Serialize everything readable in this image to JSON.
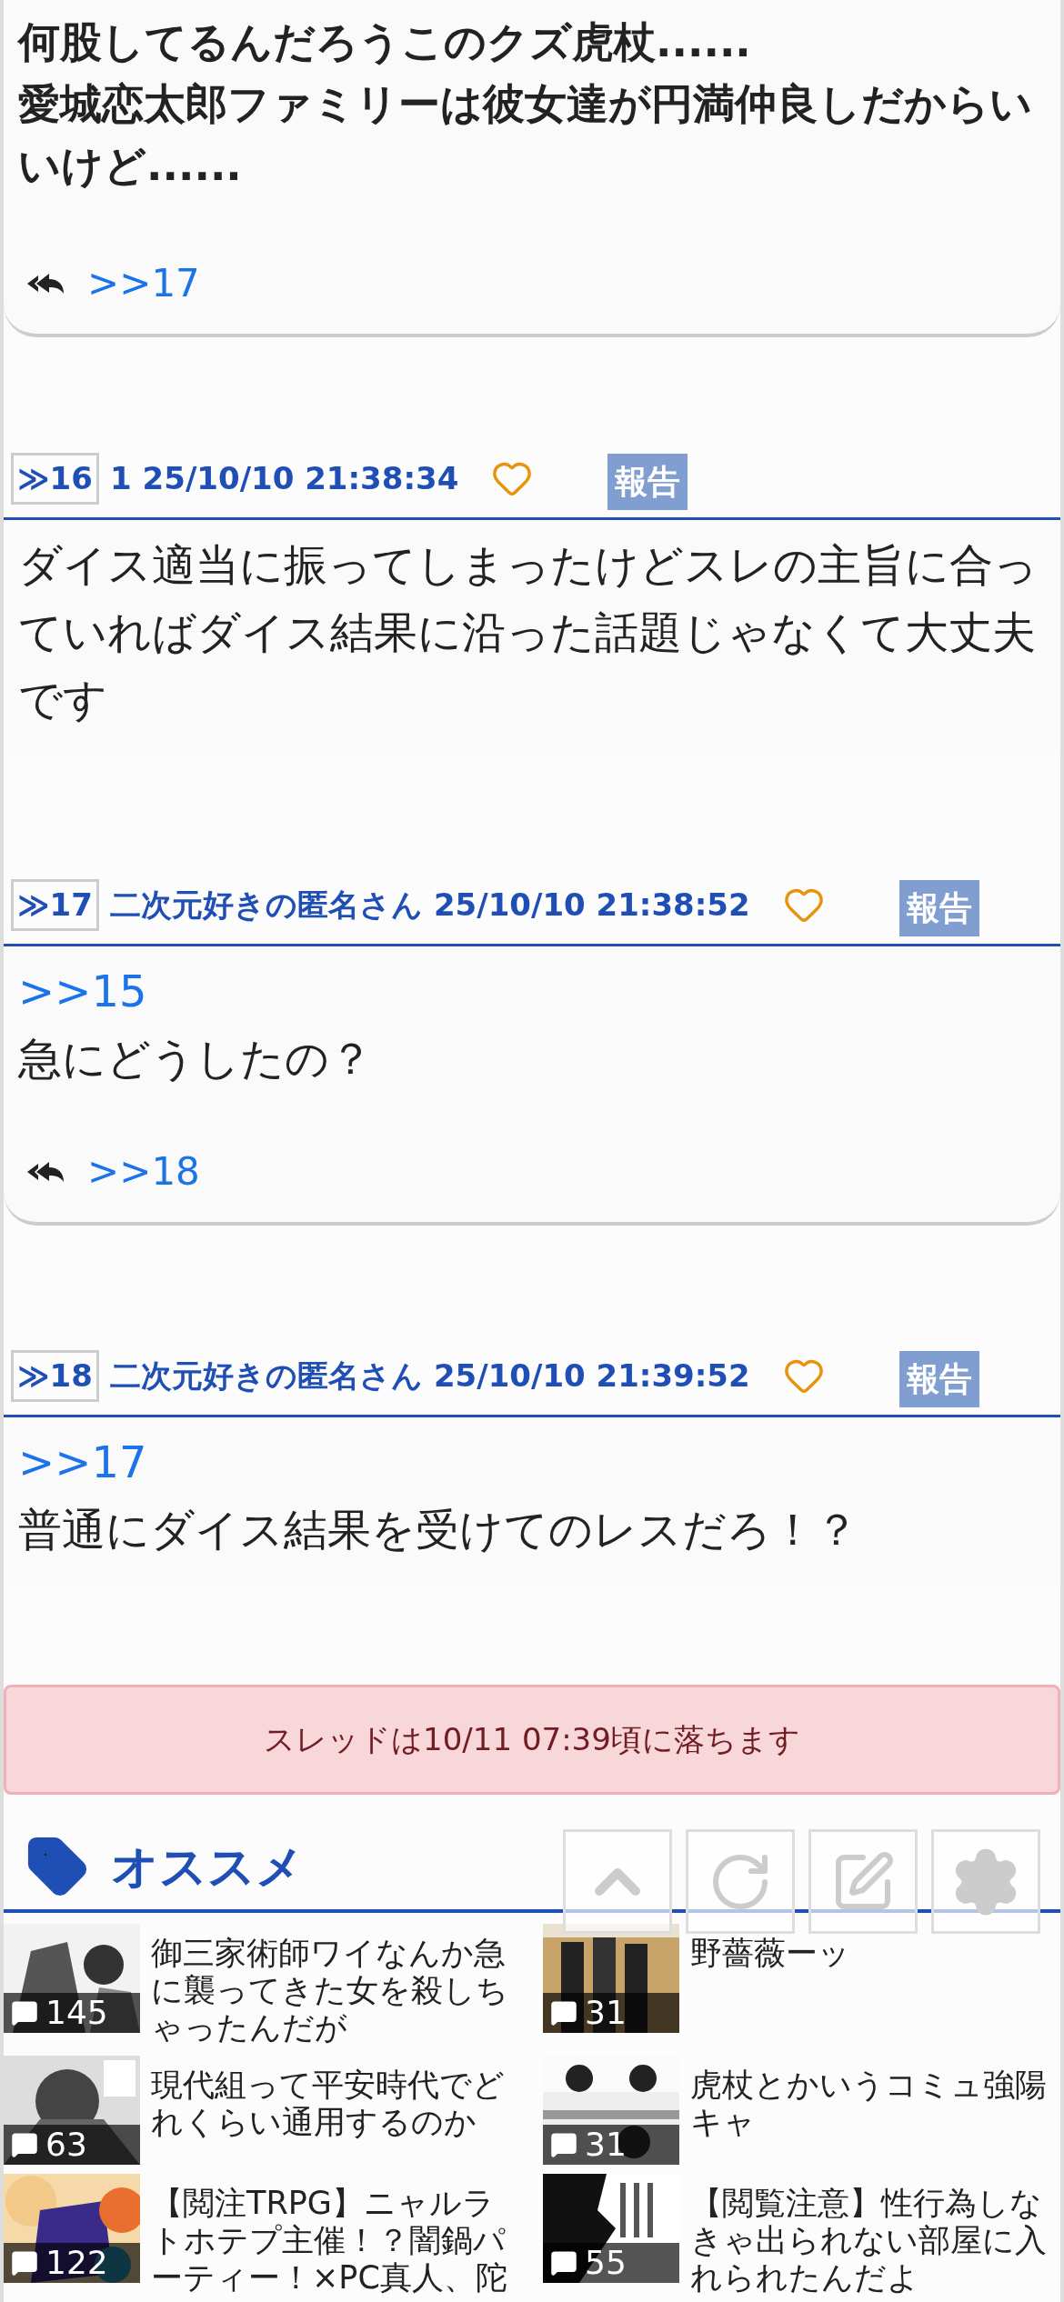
{
  "top_post": {
    "lines": [
      "何股してるんだろうこのクズ虎杖......",
      "愛城恋太郎ファミリーは彼女達が円満仲良しだからいいけど......"
    ],
    "replies": [
      ">>17"
    ]
  },
  "posts": [
    {
      "number": "≫16",
      "name": "1",
      "date": "25/10/10 21:38:34",
      "liked": false,
      "report": "報告",
      "lines": [
        "ダイス適当に振ってしまったけどスレの主旨に合っていればダイス結果に沿った話題じゃなくて大丈夫です"
      ]
    },
    {
      "number": "≫17",
      "name": "二次元好きの匿名さん",
      "date": "25/10/10 21:38:52",
      "liked": false,
      "report": "報告",
      "anchors": [
        ">>15"
      ],
      "lines": [
        "急にどうしたの？"
      ],
      "replies": [
        ">>18"
      ]
    },
    {
      "number": "≫18",
      "name": "二次元好きの匿名さん",
      "date": "25/10/10 21:39:52",
      "liked": false,
      "report": "報告",
      "anchors": [
        ">>17"
      ],
      "lines": [
        "普通にダイス結果を受けてのレスだろ！？"
      ]
    }
  ],
  "notice": "スレッドは10/11 07:39頃に落ちます",
  "recommend": {
    "title": "オススメ",
    "items": [
      {
        "title": "御三家術師ワイなんか急に襲ってきた女を殺しちゃったんだが",
        "count": "145"
      },
      {
        "title": "野薔薇ーッ",
        "count": "31"
      },
      {
        "title": "現代組って平安時代でどれくらい通用するのか",
        "count": "63"
      },
      {
        "title": "虎杖とかいうコミュ強陽キャ",
        "count": "31"
      },
      {
        "title": "【閲注TRPG】ニャルラトホテプ主催！？闇鍋パーティー！×PC真人、陀",
        "count": "122"
      },
      {
        "title": "【閲覧注意】性行為しなきゃ出られない部屋に入れられたんだよ",
        "count": "55"
      }
    ]
  },
  "floating_buttons": [
    {
      "kind": "top"
    },
    {
      "kind": "reload"
    },
    {
      "kind": "write"
    },
    {
      "kind": "settings"
    }
  ]
}
